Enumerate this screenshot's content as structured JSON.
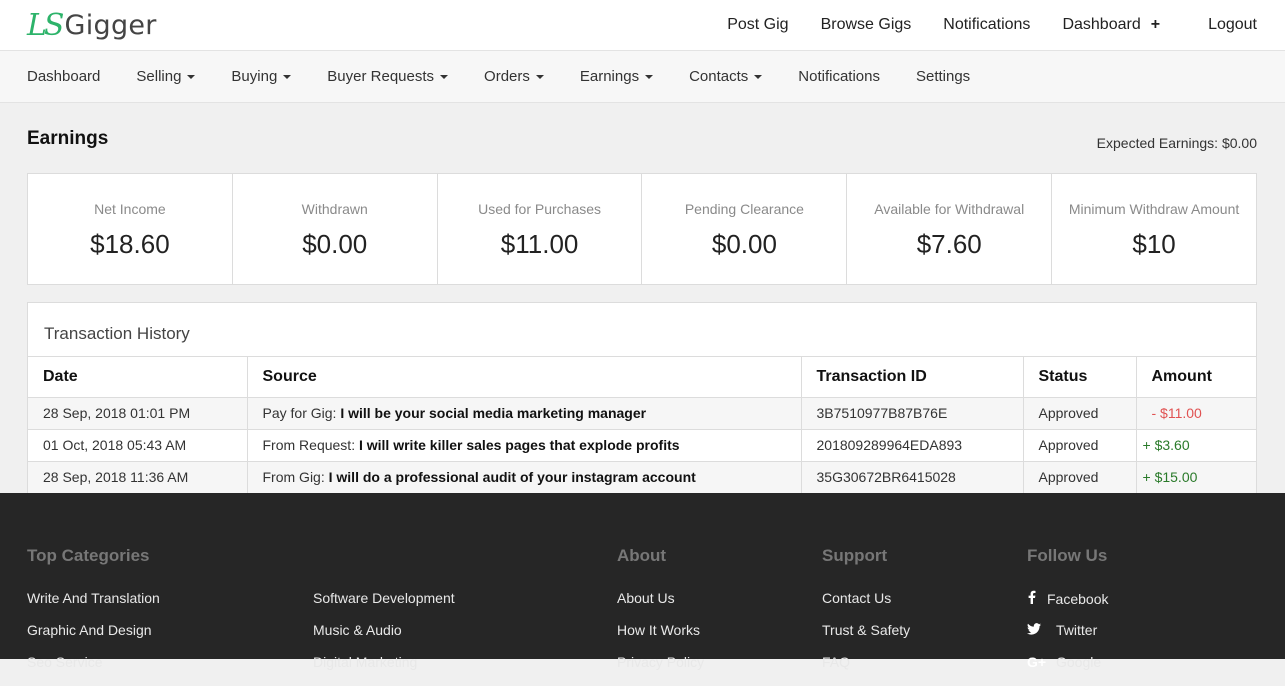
{
  "brand": {
    "logo_mark": "LS",
    "logo_name": "Gigger",
    "accent": "#2db36a"
  },
  "topnav": {
    "items": [
      "Post Gig",
      "Browse Gigs",
      "Notifications",
      "Dashboard"
    ],
    "dashboard_plus": "+",
    "logout": "Logout"
  },
  "subnav": {
    "items": [
      {
        "label": "Dashboard",
        "dropdown": false
      },
      {
        "label": "Selling",
        "dropdown": true
      },
      {
        "label": "Buying",
        "dropdown": true
      },
      {
        "label": "Buyer Requests",
        "dropdown": true
      },
      {
        "label": "Orders",
        "dropdown": true
      },
      {
        "label": "Earnings",
        "dropdown": true
      },
      {
        "label": "Contacts",
        "dropdown": true
      },
      {
        "label": "Notifications",
        "dropdown": false
      },
      {
        "label": "Settings",
        "dropdown": false
      }
    ]
  },
  "page": {
    "title": "Earnings",
    "expected_earnings": "Expected Earnings: $0.00"
  },
  "stats": [
    {
      "label": "Net Income",
      "value": "$18.60"
    },
    {
      "label": "Withdrawn",
      "value": "$0.00"
    },
    {
      "label": "Used for Purchases",
      "value": "$11.00"
    },
    {
      "label": "Pending Clearance",
      "value": "$0.00"
    },
    {
      "label": "Available for Withdrawal",
      "value": "$7.60"
    },
    {
      "label": "Minimum Withdraw Amount",
      "value": "$10"
    }
  ],
  "history": {
    "title": "Transaction History",
    "columns": [
      "Date",
      "Source",
      "Transaction ID",
      "Status",
      "Amount"
    ],
    "rows": [
      {
        "date": "28 Sep, 2018 01:01 PM",
        "source_prefix": "Pay for Gig:",
        "source_title": "I will be your social media marketing manager",
        "txid": "3B7510977B87B76E",
        "status": "Approved",
        "amount": "- $11.00",
        "type": "negative"
      },
      {
        "date": "01 Oct, 2018 05:43 AM",
        "source_prefix": "From Request:",
        "source_title": "I will write killer sales pages that explode profits",
        "txid": "201809289964EDA893",
        "status": "Approved",
        "amount": "+ $3.60",
        "type": "positive"
      },
      {
        "date": "28 Sep, 2018 11:36 AM",
        "source_prefix": "From Gig:",
        "source_title": "I will do a professional audit of your instagram account",
        "txid": "35G30672BR6415028",
        "status": "Approved",
        "amount": "+ $15.00",
        "type": "positive"
      }
    ],
    "colors": {
      "negative": "#e05252",
      "positive": "#2a7a2a"
    }
  },
  "footer": {
    "top_categories": {
      "heading": "Top Categories",
      "col1": [
        "Write And Translation",
        "Graphic And Design",
        "Seo Service"
      ],
      "col2": [
        "Software Development",
        "Music & Audio",
        "Digital Marketing"
      ]
    },
    "about": {
      "heading": "About",
      "links": [
        "About Us",
        "How It Works",
        "Privacy Policy"
      ]
    },
    "support": {
      "heading": "Support",
      "links": [
        "Contact Us",
        "Trust & Safety",
        "FAQ"
      ]
    },
    "follow": {
      "heading": "Follow Us",
      "links": [
        {
          "icon": "facebook-icon",
          "glyph": "f",
          "label": "Facebook"
        },
        {
          "icon": "twitter-icon",
          "glyph": "🐦",
          "label": "Twitter"
        },
        {
          "icon": "google-plus-icon",
          "glyph": "G+",
          "label": "Google"
        }
      ]
    }
  }
}
